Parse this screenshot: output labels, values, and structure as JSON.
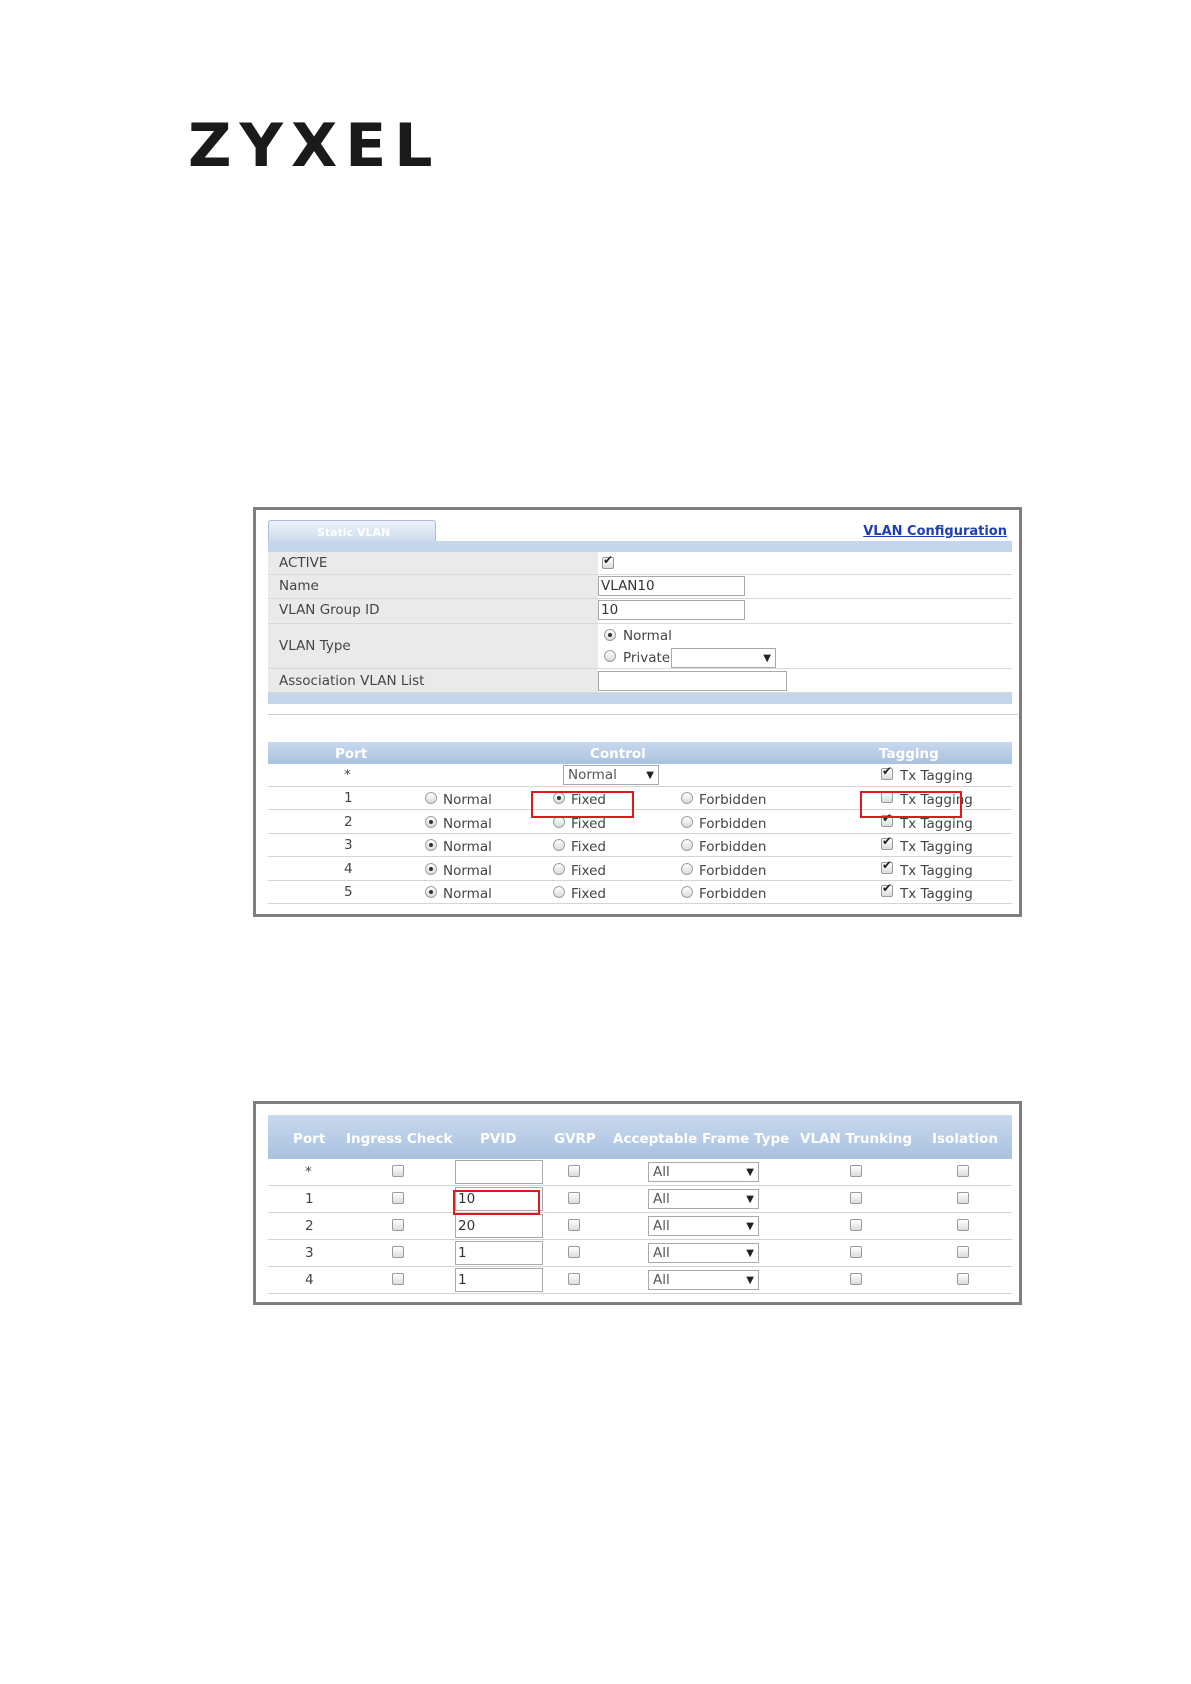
{
  "brand": {
    "logo_text": "ZYXEL"
  },
  "static_vlan": {
    "tab_label": "Static VLAN",
    "config_link": "VLAN Configuration",
    "fields": {
      "active_label": "ACTIVE",
      "active_checked": true,
      "name_label": "Name",
      "name_value": "VLAN10",
      "group_id_label": "VLAN Group ID",
      "group_id_value": "10",
      "type_label": "VLAN Type",
      "type_option_normal": "Normal",
      "type_option_private": "Private",
      "type_selected": "Normal",
      "assoc_label": "Association VLAN List",
      "assoc_value": ""
    },
    "ports_table": {
      "headers": {
        "port": "Port",
        "control": "Control",
        "tagging": "Tagging"
      },
      "all_row": {
        "port": "*",
        "control_select": "Normal",
        "tagging_label": "Tx Tagging",
        "tx_checked": true
      },
      "option_labels": {
        "normal": "Normal",
        "fixed": "Fixed",
        "forbidden": "Forbidden",
        "tx": "Tx Tagging"
      },
      "rows": [
        {
          "port": "1",
          "control": "Fixed",
          "tx_tagging": false
        },
        {
          "port": "2",
          "control": "Normal",
          "tx_tagging": true
        },
        {
          "port": "3",
          "control": "Normal",
          "tx_tagging": true
        },
        {
          "port": "4",
          "control": "Normal",
          "tx_tagging": true
        },
        {
          "port": "5",
          "control": "Normal",
          "tx_tagging": true
        }
      ]
    }
  },
  "port_settings": {
    "headers": {
      "port": "Port",
      "ingress": "Ingress Check",
      "pvid": "PVID",
      "gvrp": "GVRP",
      "frame_type": "Acceptable Frame Type",
      "trunking": "VLAN Trunking",
      "isolation": "Isolation"
    },
    "rows": [
      {
        "port": "*",
        "pvid": "",
        "frame_type": "All"
      },
      {
        "port": "1",
        "pvid": "10",
        "frame_type": "All"
      },
      {
        "port": "2",
        "pvid": "20",
        "frame_type": "All"
      },
      {
        "port": "3",
        "pvid": "1",
        "frame_type": "All"
      },
      {
        "port": "4",
        "pvid": "1",
        "frame_type": "All"
      }
    ]
  },
  "colors": {
    "highlight": "#e0191e",
    "header_blue": "#b3c8e4",
    "link_blue": "#1f3fae"
  }
}
